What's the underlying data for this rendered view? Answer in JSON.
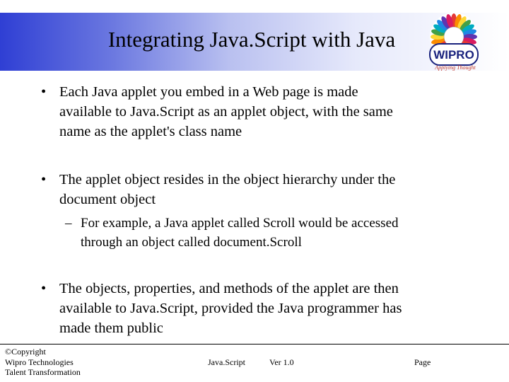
{
  "slide": {
    "title": "Integrating Java.Script with Java",
    "bullets": [
      {
        "marker": "•",
        "lines": [
          "Each Java  applet you embed in a Web page is made",
          "available to Java.Script as an applet object, with the same",
          "name as the applet's class name"
        ]
      },
      {
        "marker": "•",
        "lines": [
          "The applet object resides in the object hierarchy under the",
          "document  object"
        ]
      },
      {
        "marker": "•",
        "lines": [
          "The objects, properties, and methods of the applet are then",
          "available to Java.Script, provided the Java programmer has",
          "made them public"
        ]
      }
    ],
    "sub_bullet": {
      "marker": "–",
      "lines": [
        "For example, a Java  applet called Scroll would be accessed",
        "through an object called document.Scroll"
      ]
    }
  },
  "logo": {
    "name": "WIPRO",
    "tagline": "Applying Thought"
  },
  "footer": {
    "copyright": "©Copyright",
    "company": "Wipro Technologies",
    "division": "Talent Transformation",
    "course": "Java.Script",
    "version": "Ver 1.0",
    "page": "Page"
  },
  "colors": {
    "header_start": "#2f3fd4",
    "header_end": "#ffffff",
    "logo_text": "#1a237e",
    "tagline": "#c0392b"
  }
}
